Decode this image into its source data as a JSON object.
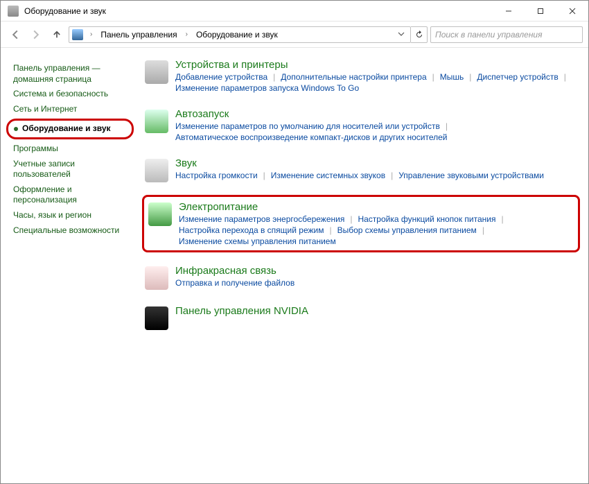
{
  "window": {
    "title": "Оборудование и звук"
  },
  "breadcrumb": {
    "root": "Панель управления",
    "current": "Оборудование и звук"
  },
  "search": {
    "placeholder": "Поиск в панели управления"
  },
  "sidebar": {
    "items": [
      {
        "label": "Панель управления — домашняя страница"
      },
      {
        "label": "Система и безопасность"
      },
      {
        "label": "Сеть и Интернет"
      },
      {
        "label": "Оборудование и звук",
        "selected": true
      },
      {
        "label": "Программы"
      },
      {
        "label": "Учетные записи пользователей"
      },
      {
        "label": "Оформление и персонализация"
      },
      {
        "label": "Часы, язык и регион"
      },
      {
        "label": "Специальные возможности"
      }
    ]
  },
  "categories": [
    {
      "id": "devices",
      "title": "Устройства и принтеры",
      "tasks": [
        "Добавление устройства",
        "Дополнительные настройки принтера",
        "Мышь",
        "Диспетчер устройств",
        "Изменение параметров запуска Windows To Go"
      ]
    },
    {
      "id": "autoplay",
      "title": "Автозапуск",
      "tasks": [
        "Изменение параметров по умолчанию для носителей или устройств",
        "Автоматическое воспроизведение компакт-дисков и других носителей"
      ]
    },
    {
      "id": "sound",
      "title": "Звук",
      "tasks": [
        "Настройка громкости",
        "Изменение системных звуков",
        "Управление звуковыми устройствами"
      ]
    },
    {
      "id": "power",
      "title": "Электропитание",
      "highlight": true,
      "tasks": [
        "Изменение параметров энергосбережения",
        "Настройка функций кнопок питания",
        "Настройка перехода в спящий режим",
        "Выбор схемы управления питанием",
        "Изменение схемы управления питанием"
      ]
    },
    {
      "id": "ir",
      "title": "Инфракрасная связь",
      "tasks": [
        "Отправка и получение файлов"
      ]
    },
    {
      "id": "nvidia",
      "title": "Панель управления NVIDIA",
      "tasks": []
    }
  ]
}
